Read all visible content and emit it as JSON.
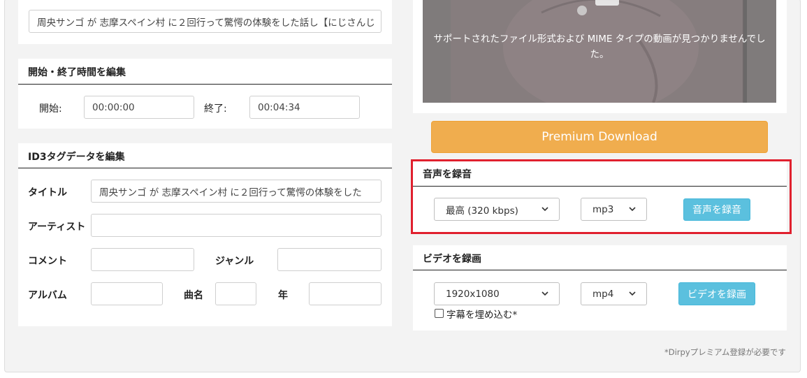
{
  "title_field": {
    "value": "周央サンゴ が 志摩スペイン村 に２回行って驚愕の体験をした話し【にじさんじ"
  },
  "time_panel": {
    "title": "開始・終了時間を編集",
    "start_label": "開始:",
    "start_value": "00:00:00",
    "end_label": "終了:",
    "end_value": "00:04:34"
  },
  "id3_panel": {
    "title": "ID3タグデータを編集",
    "title_label": "タイトル",
    "title_value": "周央サンゴ が 志摩スペイン村 に２回行って驚愕の体験をした",
    "artist_label": "アーティスト",
    "artist_value": "",
    "comment_label": "コメント",
    "comment_value": "",
    "genre_label": "ジャンル",
    "genre_value": "",
    "album_label": "アルバム",
    "album_value": "",
    "track_label": "曲名",
    "track_value": "",
    "year_label": "年",
    "year_value": ""
  },
  "video_player": {
    "error_message": "サポートされたファイル形式および MIME タイプの動画が見つかりませんでした。"
  },
  "premium_button": {
    "label": "Premium Download"
  },
  "audio_panel": {
    "title": "音声を録音",
    "quality_selected": "最高 (320 kbps)",
    "format_selected": "mp3",
    "record_label": "音声を録音"
  },
  "video_panel": {
    "title": "ビデオを録画",
    "resolution_selected": "1920x1080",
    "format_selected": "mp4",
    "record_label": "ビデオを録画",
    "subtitle_label": "字幕を埋め込む*"
  },
  "footnote": "*Dirpyプレミアム登録が必要です",
  "colors": {
    "accent_orange": "#f0ad4e",
    "button_blue": "#5bc0de",
    "highlight_red": "#e0202e"
  }
}
